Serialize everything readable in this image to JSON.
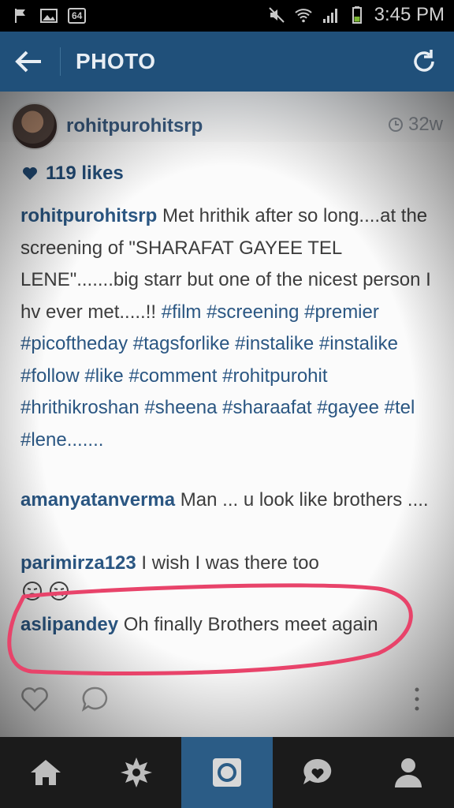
{
  "status_bar": {
    "time": "3:45 PM",
    "battery_badge": "64"
  },
  "app_bar": {
    "title": "PHOTO"
  },
  "post": {
    "username": "rohitpurohitsrp",
    "time_ago": "32w",
    "likes": "119 likes",
    "caption_user": "rohitpurohitsrp",
    "caption_text_1": " Met hrithik after so long....at the screening of \"SHARAFAT GAYEE TEL LENE\".......big starr but one of the nicest person I hv ever met.....!! ",
    "hashtags": "#film #screening #premier #picoftheday #tagsforlike #instalike #instalike #follow #like #comment #rohitpurohit #hrithikroshan #sheena #sharaafat #gayee #tel #lene......."
  },
  "comments": [
    {
      "user": "amanyatanverma",
      "text": " Man ... u look like brothers ...."
    },
    {
      "user": "parimirza123",
      "text": " I wish I was there too"
    },
    {
      "user": "aslipandey",
      "text": " Oh finally Brothers meet again"
    }
  ],
  "colors": {
    "app_bar": "#20507a",
    "link": "#2a5682",
    "highlight": "#e8436a",
    "nav_active": "#2b5c86"
  }
}
